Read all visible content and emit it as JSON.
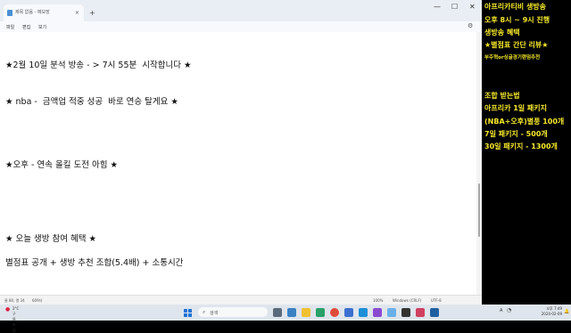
{
  "window": {
    "tab_title": "제목 없음 - 메모장",
    "tab_close": "×",
    "new_tab": "+",
    "min": "—",
    "max": "☐",
    "close": "✕"
  },
  "menu": {
    "file": "파일",
    "edit": "편집",
    "view": "보기",
    "settings_icon": "⚙"
  },
  "editor": {
    "lines": [
      "★2월 10일 분석 방송 - > 7시 55분  시작합니다 ★",
      "★ nba -  금액업 적중 성공  바로 연승 탈게요 ★",
      "★오후 - 연속 올킬 도전 아힘 ★",
      "★ 오늘 생방 참여 혜택 ★",
      "별점표 공개 + 생방 추천 조합(5.4배) + 소통시간"
    ]
  },
  "status": {
    "position": "줄 80, 열 34",
    "chars": "609자",
    "zoom": "100%",
    "eol": "Windows (CRLF)",
    "encoding": "UTF-8"
  },
  "overlay": {
    "line1": "아프리카티비 생방송",
    "line2": "오후 8시 ~ 9시 진행",
    "line3": "생방송 혜택",
    "line4": "★별점표 간단 리뷰★",
    "line5": "부주혁or싱글경기랜덤추천",
    "line6": "조합 받는법",
    "line7": "아프리카 1일 패키지",
    "line8": "(NBA+오후)별풍 100개",
    "line9": "7일 패키지 - 500개",
    "line10": "30일 패키지 - 1300개",
    "color": "#f5e82a"
  },
  "taskbar": {
    "weather_temp": "2°C",
    "weather_desc": "구름 조금",
    "search_placeholder": "검색",
    "lang": "A",
    "time": "오후 7:49",
    "date": "2024-02-09",
    "icons": [
      "task-view",
      "widgets",
      "file-explorer",
      "edge",
      "chrome",
      "store",
      "mail",
      "photos",
      "notepad",
      "app",
      "app2",
      "app3"
    ]
  }
}
